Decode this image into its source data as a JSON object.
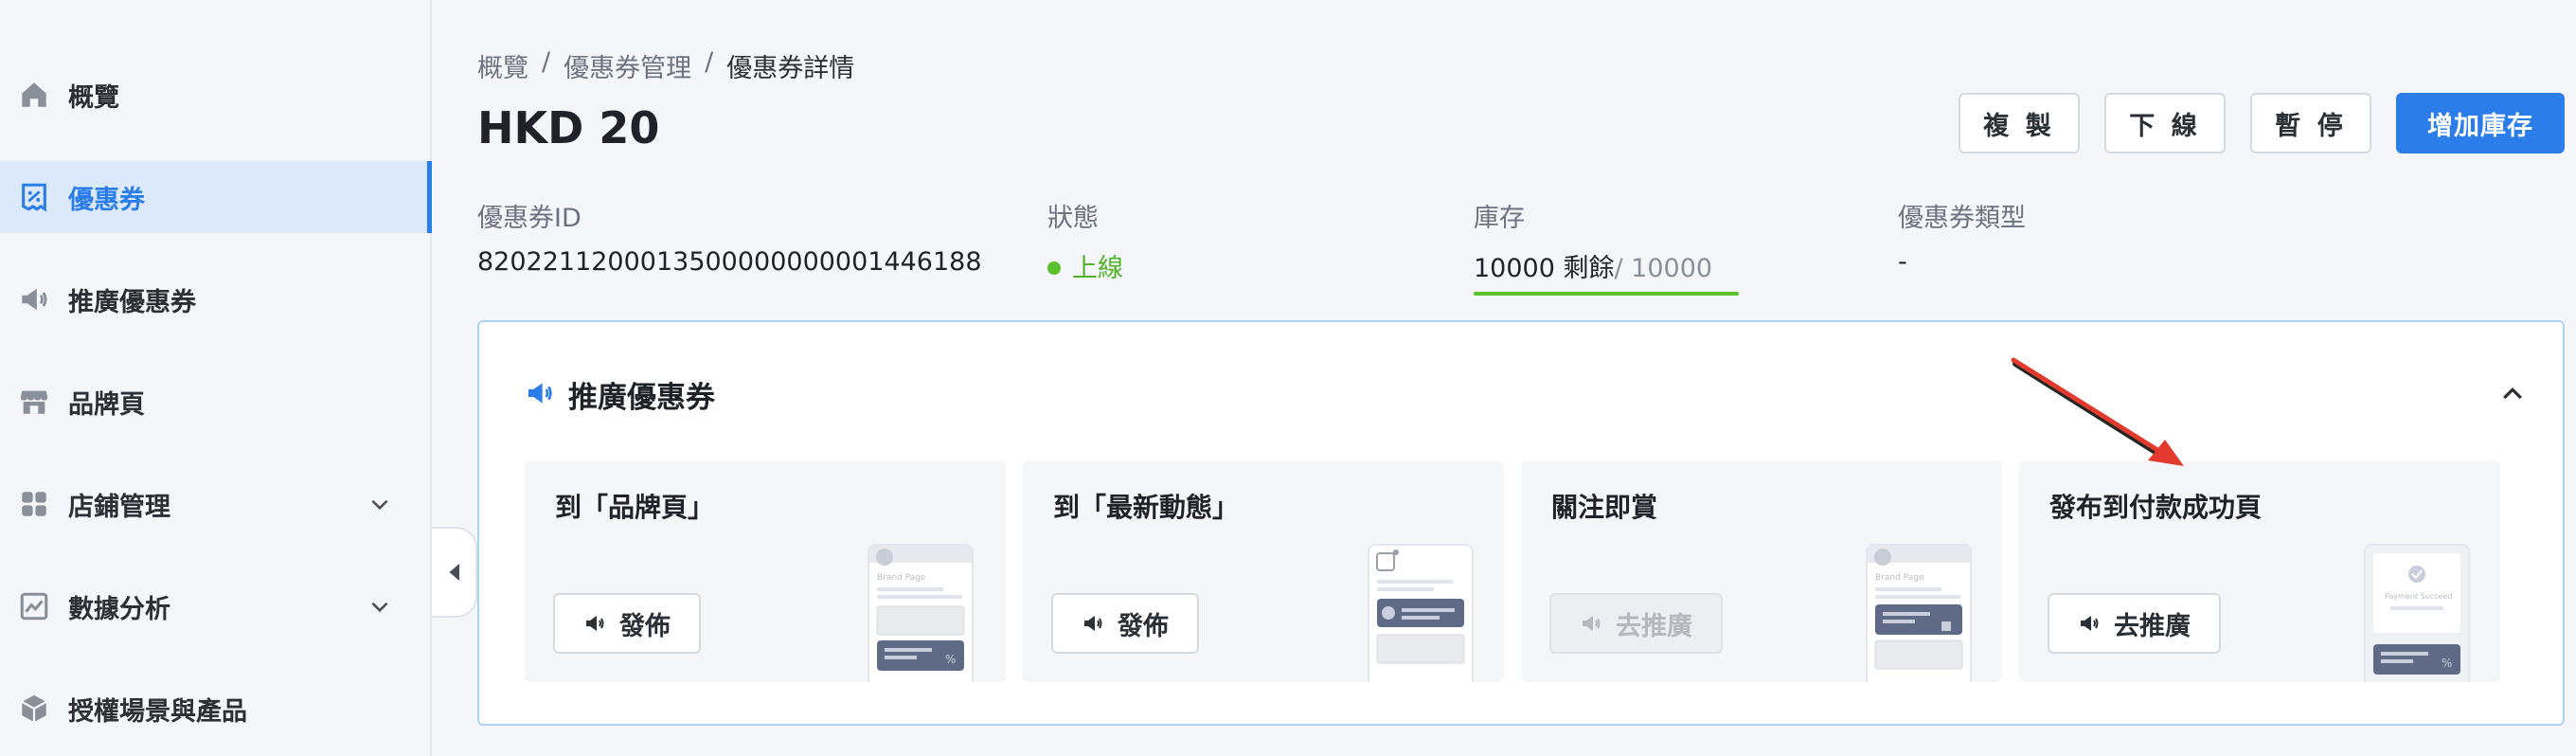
{
  "sidebar": {
    "items": [
      {
        "label": "概覽",
        "icon": "home-icon"
      },
      {
        "label": "優惠券",
        "icon": "coupon-icon",
        "active": true
      },
      {
        "label": "推廣優惠券",
        "icon": "megaphone-icon"
      },
      {
        "label": "品牌頁",
        "icon": "store-icon"
      },
      {
        "label": "店鋪管理",
        "icon": "grid-icon",
        "expandable": true
      },
      {
        "label": "數據分析",
        "icon": "chart-icon",
        "expandable": true
      },
      {
        "label": "授權場景與產品",
        "icon": "box-icon"
      }
    ]
  },
  "breadcrumb": {
    "items": [
      "概覽",
      "優惠券管理",
      "優惠券詳情"
    ],
    "separator": "/"
  },
  "page": {
    "title": "HKD 20"
  },
  "actions": {
    "copy": "複 製",
    "offline": "下 線",
    "pause": "暫 停",
    "add_stock": "增加庫存"
  },
  "info": {
    "coupon_id_label": "優惠券ID",
    "coupon_id": "8202211200013500000000001446188",
    "status_label": "狀態",
    "status": "上線",
    "stock_label": "庫存",
    "stock_remaining": "10000 剩餘",
    "stock_total": "/ 10000",
    "type_label": "優惠券類型",
    "type": "-"
  },
  "promo": {
    "title": "推廣優惠券",
    "tiles": [
      {
        "title": "到「品牌頁」",
        "button": "發佈",
        "disabled": false,
        "preview_text": "Brand Page"
      },
      {
        "title": "到「最新動態」",
        "button": "發佈",
        "disabled": false,
        "preview_text": ""
      },
      {
        "title": "關注即賞",
        "button": "去推廣",
        "disabled": true,
        "preview_text": "Brand Page"
      },
      {
        "title": "發布到付款成功頁",
        "button": "去推廣",
        "disabled": false,
        "preview_text": "Payment Succeed"
      }
    ]
  },
  "colors": {
    "accent": "#2b7de9",
    "active_bg": "#dbe9fb",
    "success": "#52b22a",
    "annotation_arrow": "#e23b2e"
  }
}
